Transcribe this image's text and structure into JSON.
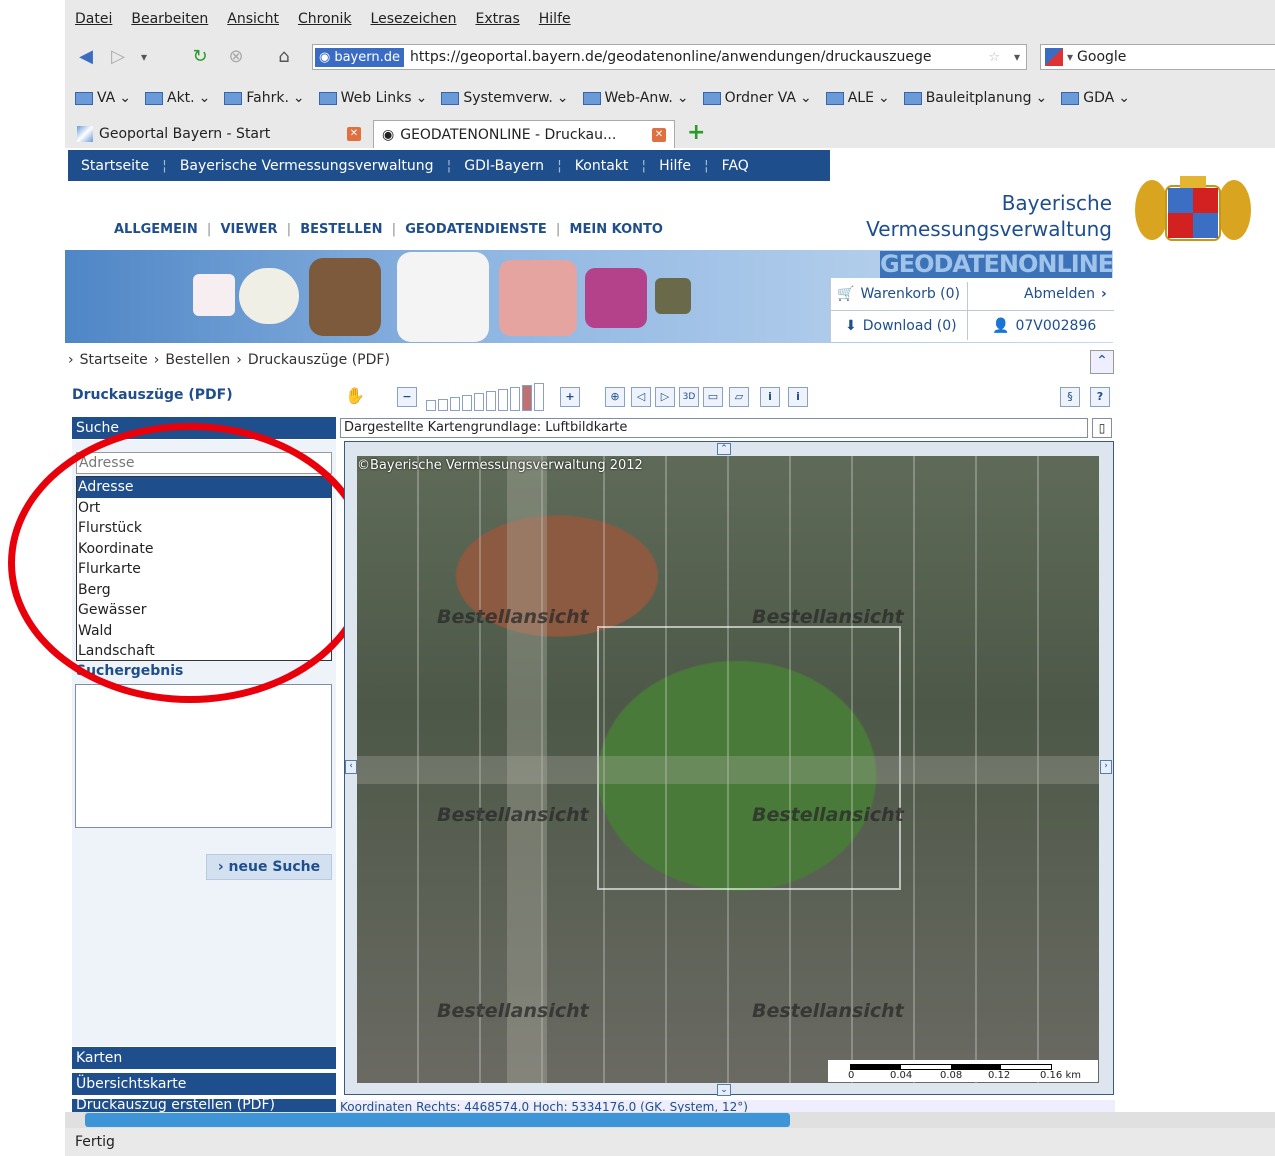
{
  "menu": [
    "Datei",
    "Bearbeiten",
    "Ansicht",
    "Chronik",
    "Lesezeichen",
    "Extras",
    "Hilfe"
  ],
  "nav": {
    "site_label": "bayern.de",
    "url": "https://geoportal.bayern.de/geodatenonline/anwendungen/druckauszuege",
    "search_engine": "Google"
  },
  "bookmarks": [
    "VA",
    "Akt.",
    "Fahrk.",
    "Web Links",
    "Systemverw.",
    "Web-Anw.",
    "Ordner VA",
    "ALE",
    "Bauleitplanung",
    "GDA"
  ],
  "tabs": [
    {
      "label": "Geoportal Bayern - Start"
    },
    {
      "label": "GEODATENONLINE - Druckau..."
    }
  ],
  "topnav": [
    "Startseite",
    "Bayerische Vermessungsverwaltung",
    "GDI-Bayern",
    "Kontakt",
    "Hilfe",
    "FAQ"
  ],
  "brand": {
    "line1": "Bayerische",
    "line2": "Vermessungsverwaltung",
    "product": "GEODATENONLINE"
  },
  "mainnav": [
    "ALLGEMEIN",
    "VIEWER",
    "BESTELLEN",
    "GEODATENDIENSTE",
    "MEIN KONTO"
  ],
  "account": {
    "cart": "Warenkorb (0)",
    "logout": "Abmelden",
    "download": "Download (0)",
    "user": "07V002896"
  },
  "breadcrumb": [
    "Startseite",
    "Bestellen",
    "Druckauszüge (PDF)"
  ],
  "panel": {
    "title": "Druckauszüge (PDF)",
    "search_header": "Suche",
    "select_value": "Adresse",
    "options": [
      "Adresse",
      "Ort",
      "Flurstück",
      "Koordinate",
      "Flurkarte",
      "Berg",
      "Gewässer",
      "Wald",
      "Landschaft"
    ],
    "result_header": "Suchergebnis",
    "new_search": "neue Suche",
    "sections": [
      "Karten",
      "Übersichtskarte",
      "Druckauszug erstellen (PDF)"
    ]
  },
  "map": {
    "base_layer": "Dargestellte Kartengrundlage: Luftbildkarte",
    "copyright": "©Bayerische Vermessungsverwaltung 2012",
    "overlay_label": "Bestellansicht",
    "scale_ticks": [
      "0",
      "0.04",
      "0.08",
      "0.12",
      "0.16 km"
    ],
    "coordinates": "Koordinaten Rechts: 4468574.0 Hoch: 5334176.0 (GK. System, 12°)"
  },
  "status": "Fertig"
}
